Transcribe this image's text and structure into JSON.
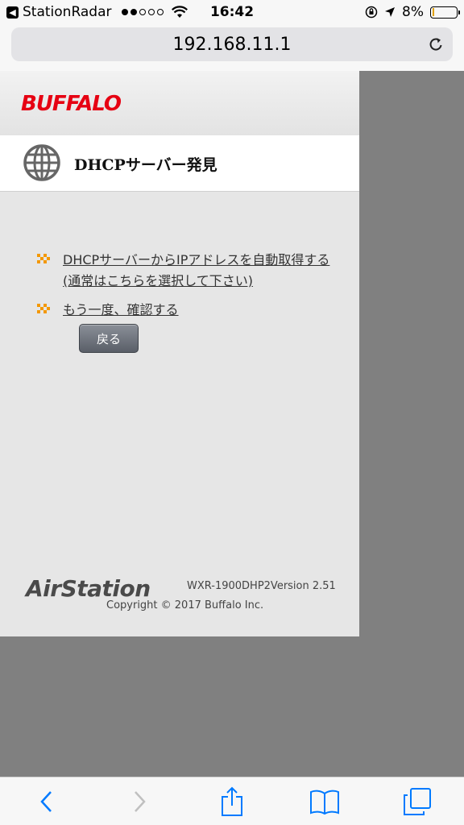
{
  "status_bar": {
    "app_name": "StationRadar",
    "time": "16:42",
    "battery_percent": "8%",
    "battery_level": 0.08,
    "signal_bars": 2
  },
  "browser": {
    "url": "192.168.11.1"
  },
  "page": {
    "brand": "BUFFALO",
    "title": "DHCPサーバー発見",
    "links": [
      {
        "text": "DHCPサーバーからIPアドレスを自動取得する(通常はこちらを選択して下さい)"
      },
      {
        "text": "もう一度、確認する"
      }
    ],
    "back_button_label": "戻る",
    "footer": {
      "product_logo": "AirStation",
      "model_version": "WXR-1900DHP2Version 2.51",
      "copyright": "Copyright © 2017 Buffalo Inc."
    }
  },
  "colors": {
    "brand_red": "#e60012",
    "bullet_orange": "#f39800",
    "ios_blue": "#007aff"
  }
}
